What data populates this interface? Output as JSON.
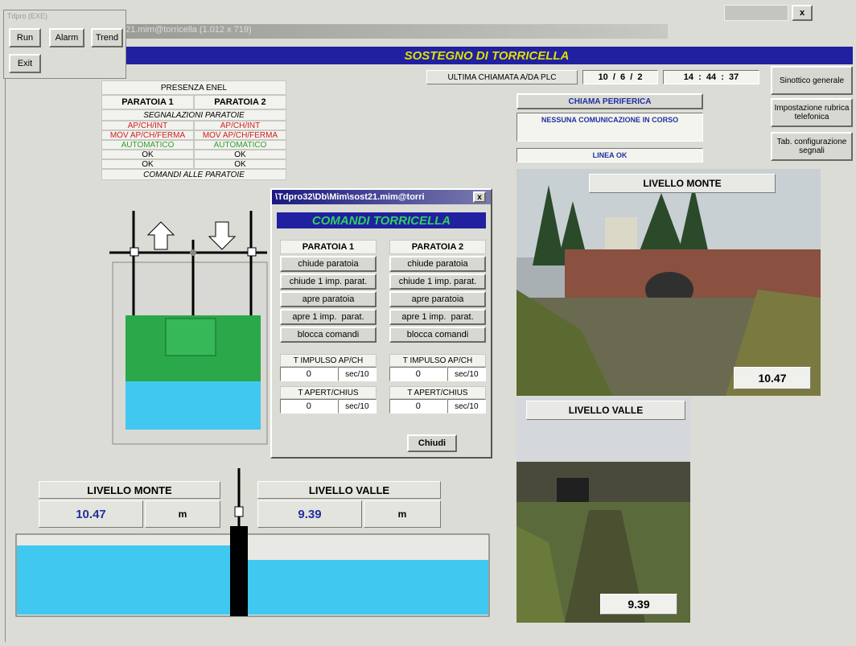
{
  "top_window": {
    "title": "21.mim@torricella (1.012 x 719)",
    "close": "x"
  },
  "launcher": {
    "title": "Tdpro (EXE)",
    "run": "Run",
    "alarm": "Alarm",
    "trend": "Trend",
    "exit": "Exit"
  },
  "banner": {
    "title": "SOSTEGNO DI TORRICELLA"
  },
  "plc": {
    "label": "ULTIMA CHIAMATA A/DA PLC",
    "date": "10  /  6  /  2",
    "time": "14  :  44  :  37"
  },
  "nav": {
    "sinottico": "Sinottico generale",
    "rubrica": "Impostazione rubrica telefonica",
    "tab_config": "Tab. configurazione segnali"
  },
  "comm": {
    "chiama": "CHIAMA PERIFERICA",
    "status": "NESSUNA COMUNICAZIONE IN CORSO",
    "linea": "LINEA OK"
  },
  "status_table": {
    "presenza": "PRESENZA ENEL",
    "h1": "PARATOIA 1",
    "h2": "PARATOIA 2",
    "segnalazioni": "SEGNALAZIONI PARATOIE",
    "rows": [
      [
        "AP/CH/INT",
        "AP/CH/INT"
      ],
      [
        "MOV AP/CH/FERMA",
        "MOV AP/CH/FERMA"
      ],
      [
        "AUTOMATICO",
        "AUTOMATICO"
      ],
      [
        "OK",
        "OK"
      ],
      [
        "OK",
        "OK"
      ]
    ],
    "comandi": "COMANDI ALLE PARATOIE",
    "colors": {
      "red": "#d02020",
      "green": "#30a030"
    }
  },
  "dialog": {
    "title": "\\Tdpro32\\Db\\Mim\\sost21.mim@torri",
    "close": "x",
    "header": "COMANDI TORRICELLA",
    "col1": {
      "title": "PARATOIA 1",
      "buttons": [
        "chiude paratoia",
        "chiude 1 imp. parat.",
        "apre paratoia",
        "apre 1 imp.  parat.",
        "blocca comandi"
      ],
      "timp_label": "T IMPULSO AP/CH",
      "timp_val": "0",
      "timp_unit": "sec/10",
      "tap_label": "T APERT/CHIUS",
      "tap_val": "0",
      "tap_unit": "sec/10"
    },
    "col2": {
      "title": "PARATOIA 2",
      "buttons": [
        "chiude paratoia",
        "chiude 1 imp. parat.",
        "apre paratoia",
        "apre 1 imp.  parat.",
        "blocca comandi"
      ],
      "timp_label": "T IMPULSO AP/CH",
      "timp_val": "0",
      "timp_unit": "sec/10",
      "tap_label": "T APERT/CHIUS",
      "tap_val": "0",
      "tap_unit": "sec/10"
    },
    "close_btn": "Chiudi"
  },
  "levels": {
    "monte_label": "LIVELLO MONTE",
    "monte_value": "10.47",
    "monte_unit": "m",
    "valle_label": "LIVELLO VALLE",
    "valle_value": "9.39",
    "valle_unit": "m"
  },
  "photos": {
    "monte_label": "LIVELLO MONTE",
    "monte_value": "10.47",
    "valle_label": "LIVELLO VALLE",
    "valle_value": "9.39"
  },
  "colors": {
    "banner": "#2020a0",
    "banner_text": "#e0e000",
    "water": "#40c8f0",
    "gate_green": "#30b050"
  }
}
